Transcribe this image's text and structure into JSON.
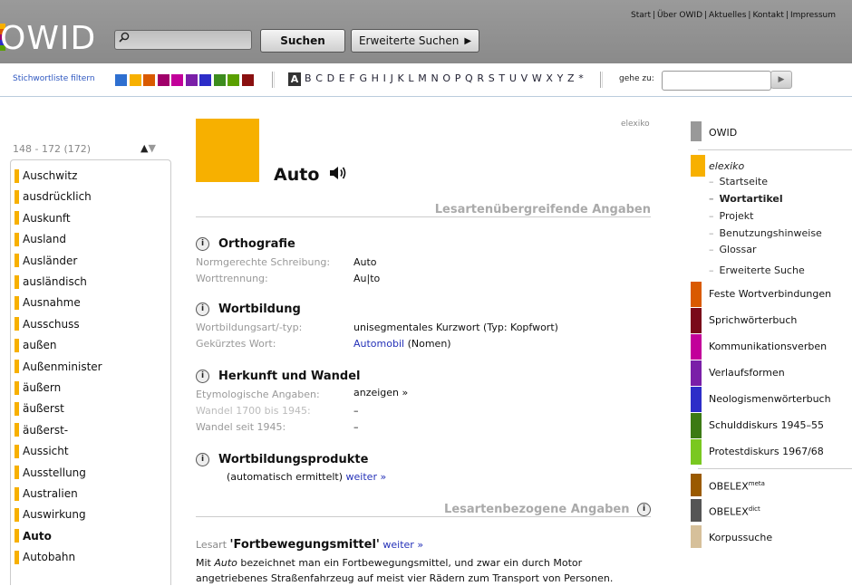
{
  "header": {
    "logo": "OWID",
    "search_placeholder": "",
    "search_button": "Suchen",
    "advanced_button": "Erweiterte Suchen",
    "top_links": [
      "Start",
      "Über OWID",
      "Aktuelles",
      "Kontakt",
      "Impressum"
    ]
  },
  "filterbar": {
    "label": "Stichwortliste filtern",
    "swatch_colors": [
      "#2e6fd0",
      "#f7b000",
      "#d95a00",
      "#a0006a",
      "#c2009a",
      "#7a1fa8",
      "#2d2dc8",
      "#3c8c1e",
      "#5aa000",
      "#8a1010"
    ],
    "active_letter": "A",
    "alphabet": "B C D E F G H I J K L M N O P Q R S T U V W X Y Z *",
    "goto_label": "gehe zu:",
    "goto_value": ""
  },
  "wordlist": {
    "range": "148 - 172 (172)",
    "items": [
      "Auschwitz",
      "ausdrücklich",
      "Auskunft",
      "Ausland",
      "Ausländer",
      "ausländisch",
      "Ausnahme",
      "Ausschuss",
      "außen",
      "Außenminister",
      "äußern",
      "äußerst",
      "äußerst-",
      "Aussicht",
      "Ausstellung",
      "Australien",
      "Auswirkung",
      "Auto",
      "Autobahn"
    ],
    "active": "Auto"
  },
  "entry": {
    "source": "elexiko",
    "headword": "Auto",
    "general_heading": "Lesartenübergreifende Angaben",
    "orthografie": {
      "title": "Orthografie",
      "normgerecht_label": "Normgerechte Schreibung:",
      "normgerecht_value": "Auto",
      "worttrennung_label": "Worttrennung:",
      "worttrennung_value": "Au|to"
    },
    "wortbildung": {
      "title": "Wortbildung",
      "art_label": "Wortbildungsart/-typ:",
      "art_value": "unisegmentales Kurzwort (Typ: Kopfwort)",
      "gekuerzt_label": "Gekürztes Wort:",
      "gekuerzt_link": "Automobil",
      "gekuerzt_suffix": " (Nomen)"
    },
    "herkunft": {
      "title": "Herkunft und Wandel",
      "etym_label": "Etymologische Angaben:",
      "etym_link": "anzeigen »",
      "w1_label": "Wandel 1700 bis 1945:",
      "w1_value": "–",
      "w2_label": "Wandel seit 1945:",
      "w2_value": "–"
    },
    "produkte": {
      "title": "Wortbildungsprodukte",
      "note": "(automatisch ermittelt)",
      "link": "weiter »"
    },
    "specific_heading": "Lesartenbezogene Angaben",
    "lesart_prefix": "Lesart",
    "lesart_title": "'Fortbewegungsmittel'",
    "lesart_link": "weiter »",
    "lesart_text_1": "Mit ",
    "lesart_text_em": "Auto",
    "lesart_text_2": " bezeichnet man ein Fortbewegungsmittel, und zwar ein durch Motor angetriebenes Straßenfahrzeug auf meist vier Rädern zum Transport von Personen."
  },
  "rightnav": {
    "owid": "OWID",
    "elexiko": "elexiko",
    "elexiko_sub": [
      "Startseite",
      "Wortartikel",
      "Projekt",
      "Benutzungshinweise",
      "Glossar",
      "Erweiterte Suche"
    ],
    "elexiko_active": "Wortartikel",
    "items": [
      {
        "label": "Feste Wortverbindungen",
        "color": "#d95a00"
      },
      {
        "label": "Sprichwörterbuch",
        "color": "#7a0a1a"
      },
      {
        "label": "Kommunikationsverben",
        "color": "#c2009a"
      },
      {
        "label": "Verlaufsformen",
        "color": "#7a1fa8"
      },
      {
        "label": "Neologismenwörterbuch",
        "color": "#2d2dc8"
      },
      {
        "label": "Schulddiskurs 1945–55",
        "color": "#3c7a14"
      },
      {
        "label": "Protestdiskurs 1967/68",
        "color": "#7ac820"
      }
    ],
    "obelex_meta": "OBELEX",
    "obelex_meta_sup": "meta",
    "obelex_dict": "OBELEX",
    "obelex_dict_sup": "dict",
    "korpussuche": "Korpussuche",
    "colors": {
      "owid": "#999999",
      "elexiko": "#f7b000",
      "obelex_meta": "#9a5a00",
      "obelex_dict": "#555555",
      "korpus": "#d6c09a"
    }
  }
}
